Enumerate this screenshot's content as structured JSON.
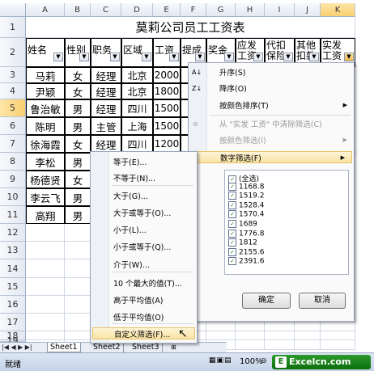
{
  "columns": [
    "A",
    "B",
    "C",
    "D",
    "E",
    "F",
    "G",
    "H",
    "I",
    "J",
    "K"
  ],
  "rows": [
    "1",
    "2",
    "3",
    "4",
    "5",
    "6",
    "7",
    "8",
    "9",
    "10",
    "11",
    "12",
    "13",
    "14",
    "15",
    "16",
    "17",
    "18",
    "19"
  ],
  "sheet_title": "莫莉公司员工工资表",
  "headers": [
    "姓名",
    "性别",
    "职务",
    "区域",
    "工资",
    "提成",
    "奖金",
    "应发\n工资",
    "代扣\n保险",
    "其他\n扣款",
    "实发\n工资"
  ],
  "data_rows": [
    [
      "马莉",
      "女",
      "经理",
      "北京",
      "2000",
      "1"
    ],
    [
      "尹颖",
      "女",
      "经理",
      "北京",
      "1800",
      "5"
    ],
    [
      "鲁治敏",
      "男",
      "经理",
      "四川",
      "1500",
      "3"
    ],
    [
      "陈明",
      "男",
      "主管",
      "上海",
      "1500",
      "3"
    ],
    [
      "徐海霞",
      "女",
      "经理",
      "四川",
      "1200",
      "2"
    ],
    [
      "李松",
      "男"
    ],
    [
      "杨德贤",
      "女"
    ],
    [
      "李云飞",
      "男"
    ],
    [
      "高翔",
      "男"
    ]
  ],
  "sort_menu": {
    "asc": "升序(S)",
    "desc": "降序(O)",
    "by_color": "按颜色排序(T)",
    "clear": "从 \"实发 工资\" 中清除筛选(C)",
    "filter_color": "按颜色筛选(I)",
    "number_filter": "数字筛选(F)"
  },
  "number_submenu": [
    "等于(E)...",
    "不等于(N)...",
    "大于(G)...",
    "大于或等于(O)...",
    "小于(L)...",
    "小于或等于(Q)...",
    "介于(W)...",
    "10 个最大的值(T)...",
    "高于平均值(A)",
    "低于平均值(O)",
    "自定义筛选(F)..."
  ],
  "value_list": [
    "(全选)",
    "1168.8",
    "1519.2",
    "1528.4",
    "1570.4",
    "1689",
    "1776.8",
    "1812",
    "2155.6",
    "2391.6"
  ],
  "ok_label": "确定",
  "cancel_label": "取消",
  "tabs": [
    "Sheet1",
    "Sheet2",
    "Sheet3"
  ],
  "status_ready": "就绪",
  "zoom": "100%",
  "watermark": "Excelcn.com"
}
